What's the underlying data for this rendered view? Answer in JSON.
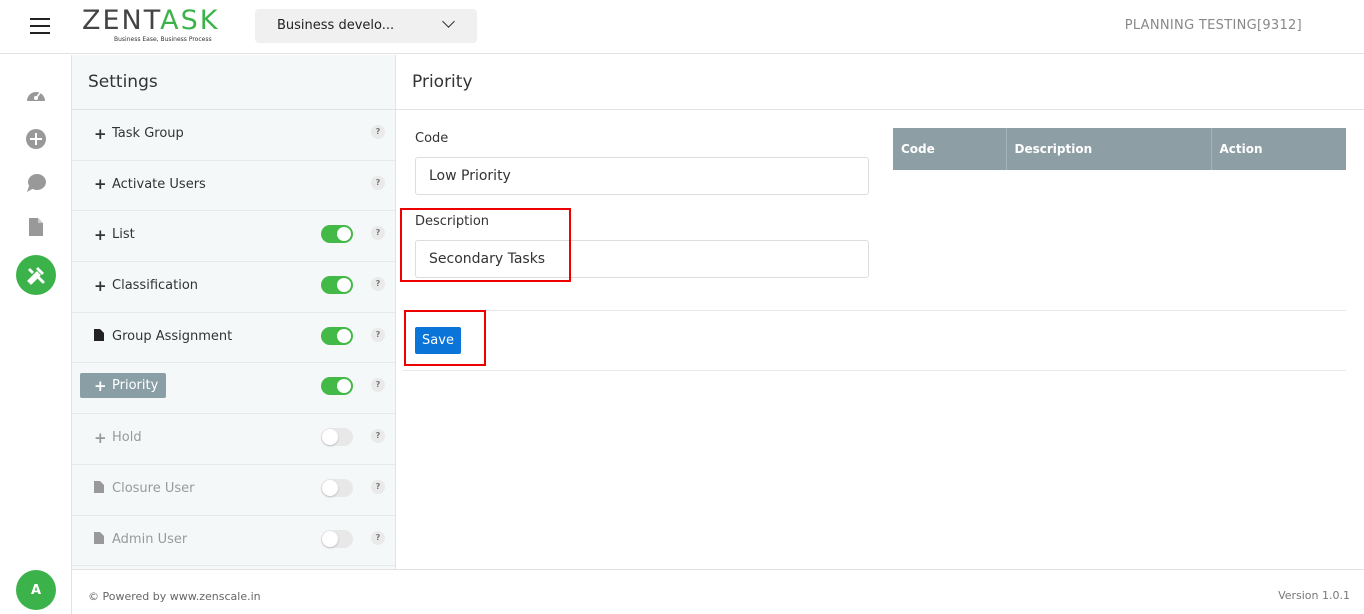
{
  "header": {
    "logo": {
      "prefix": "ZENT",
      "accent": "A",
      "suffix": "SK",
      "tagline": "Business Ease, Business Process"
    },
    "project_select": "Business develo...",
    "user": "PLANNING TESTING[9312]"
  },
  "rail": {
    "icons": [
      "dashboard-icon",
      "add-circle-icon",
      "chat-icon",
      "document-icon",
      "tools-icon"
    ],
    "avatar_initial": "A"
  },
  "settings": {
    "title": "Settings",
    "items": [
      {
        "label": "Task Group",
        "icon": "plus",
        "toggle": null,
        "state": "normal"
      },
      {
        "label": "Activate Users",
        "icon": "plus",
        "toggle": null,
        "state": "normal"
      },
      {
        "label": "List",
        "icon": "plus",
        "toggle": "on",
        "state": "normal"
      },
      {
        "label": "Classification",
        "icon": "plus",
        "toggle": "on",
        "state": "normal"
      },
      {
        "label": "Group Assignment",
        "icon": "file",
        "toggle": "on",
        "state": "normal"
      },
      {
        "label": "Priority",
        "icon": "plus",
        "toggle": "on",
        "state": "active"
      },
      {
        "label": "Hold",
        "icon": "plus",
        "toggle": "off",
        "state": "disabled"
      },
      {
        "label": "Closure User",
        "icon": "file",
        "toggle": "off",
        "state": "disabled"
      },
      {
        "label": "Admin User",
        "icon": "file",
        "toggle": "off",
        "state": "disabled"
      }
    ],
    "help": "?"
  },
  "main": {
    "title": "Priority",
    "code_label": "Code",
    "code_value": "Low Priority",
    "description_label": "Description",
    "description_value": "Secondary Tasks",
    "save_label": "Save",
    "grid_headers": [
      "Code",
      "Description",
      "Action"
    ]
  },
  "footer": {
    "powered": "© Powered by www.zenscale.in",
    "version": "Version 1.0.1"
  },
  "colors": {
    "brand_green": "#3cb34a",
    "primary_blue": "#0a74d9",
    "grid_header": "#8e9ea5",
    "highlight": "#ee0000"
  }
}
